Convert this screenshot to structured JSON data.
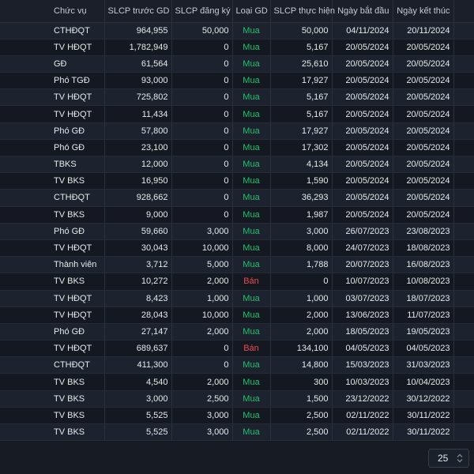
{
  "table": {
    "headers": {
      "role": "Chức vụ",
      "before": "SLCP trước GD",
      "registered": "SLCP đăng ký",
      "type": "Loại GD",
      "executed": "SLCP thực hiện",
      "start": "Ngày bắt đầu",
      "end": "Ngày kết thúc"
    },
    "rows": [
      {
        "role": "CTHĐQT",
        "before": "964,955",
        "registered": "50,000",
        "type": "Mua",
        "executed": "50,000",
        "start": "04/11/2024",
        "end": "20/11/2024"
      },
      {
        "role": "TV HĐQT",
        "before": "1,782,949",
        "registered": "0",
        "type": "Mua",
        "executed": "5,167",
        "start": "20/05/2024",
        "end": "20/05/2024"
      },
      {
        "role": "GĐ",
        "before": "61,564",
        "registered": "0",
        "type": "Mua",
        "executed": "25,610",
        "start": "20/05/2024",
        "end": "20/05/2024"
      },
      {
        "role": "Phó TGĐ",
        "before": "93,000",
        "registered": "0",
        "type": "Mua",
        "executed": "17,927",
        "start": "20/05/2024",
        "end": "20/05/2024"
      },
      {
        "role": "TV HĐQT",
        "before": "725,802",
        "registered": "0",
        "type": "Mua",
        "executed": "5,167",
        "start": "20/05/2024",
        "end": "20/05/2024"
      },
      {
        "role": "TV HĐQT",
        "before": "11,434",
        "registered": "0",
        "type": "Mua",
        "executed": "5,167",
        "start": "20/05/2024",
        "end": "20/05/2024"
      },
      {
        "role": "Phó GĐ",
        "before": "57,800",
        "registered": "0",
        "type": "Mua",
        "executed": "17,927",
        "start": "20/05/2024",
        "end": "20/05/2024"
      },
      {
        "role": "Phó GĐ",
        "before": "23,100",
        "registered": "0",
        "type": "Mua",
        "executed": "17,302",
        "start": "20/05/2024",
        "end": "20/05/2024"
      },
      {
        "role": "TBKS",
        "before": "12,000",
        "registered": "0",
        "type": "Mua",
        "executed": "4,134",
        "start": "20/05/2024",
        "end": "20/05/2024"
      },
      {
        "role": "TV BKS",
        "before": "16,950",
        "registered": "0",
        "type": "Mua",
        "executed": "1,590",
        "start": "20/05/2024",
        "end": "20/05/2024"
      },
      {
        "role": "CTHĐQT",
        "before": "928,662",
        "registered": "0",
        "type": "Mua",
        "executed": "36,293",
        "start": "20/05/2024",
        "end": "20/05/2024"
      },
      {
        "role": "TV BKS",
        "before": "9,000",
        "registered": "0",
        "type": "Mua",
        "executed": "1,987",
        "start": "20/05/2024",
        "end": "20/05/2024"
      },
      {
        "role": "Phó GĐ",
        "before": "59,660",
        "registered": "3,000",
        "type": "Mua",
        "executed": "3,000",
        "start": "26/07/2023",
        "end": "23/08/2023"
      },
      {
        "role": "TV HĐQT",
        "before": "30,043",
        "registered": "10,000",
        "type": "Mua",
        "executed": "8,000",
        "start": "24/07/2023",
        "end": "18/08/2023"
      },
      {
        "role": "Thành viên",
        "before": "3,712",
        "registered": "5,000",
        "type": "Mua",
        "executed": "1,788",
        "start": "20/07/2023",
        "end": "16/08/2023"
      },
      {
        "role": "TV BKS",
        "before": "10,272",
        "registered": "2,000",
        "type": "Bán",
        "executed": "0",
        "start": "10/07/2023",
        "end": "10/08/2023"
      },
      {
        "role": "TV HĐQT",
        "before": "8,423",
        "registered": "1,000",
        "type": "Mua",
        "executed": "1,000",
        "start": "03/07/2023",
        "end": "18/07/2023"
      },
      {
        "role": "TV HĐQT",
        "before": "28,043",
        "registered": "10,000",
        "type": "Mua",
        "executed": "2,000",
        "start": "13/06/2023",
        "end": "11/07/2023"
      },
      {
        "role": "Phó GĐ",
        "before": "27,147",
        "registered": "2,000",
        "type": "Mua",
        "executed": "2,000",
        "start": "18/05/2023",
        "end": "19/05/2023"
      },
      {
        "role": "TV HĐQT",
        "before": "689,637",
        "registered": "0",
        "type": "Bán",
        "executed": "134,100",
        "start": "04/05/2023",
        "end": "04/05/2023"
      },
      {
        "role": "CTHĐQT",
        "before": "411,300",
        "registered": "0",
        "type": "Mua",
        "executed": "14,800",
        "start": "15/03/2023",
        "end": "31/03/2023"
      },
      {
        "role": "TV BKS",
        "before": "4,540",
        "registered": "2,000",
        "type": "Mua",
        "executed": "300",
        "start": "10/03/2023",
        "end": "10/04/2023"
      },
      {
        "role": "TV BKS",
        "before": "3,000",
        "registered": "2,500",
        "type": "Mua",
        "executed": "1,500",
        "start": "23/12/2022",
        "end": "30/12/2022"
      },
      {
        "role": "TV BKS",
        "before": "5,525",
        "registered": "3,000",
        "type": "Mua",
        "executed": "2,500",
        "start": "02/11/2022",
        "end": "30/11/2022"
      },
      {
        "role": "TV BKS",
        "before": "5,525",
        "registered": "3,000",
        "type": "Mua",
        "executed": "2,500",
        "start": "02/11/2022",
        "end": "30/11/2022"
      }
    ]
  },
  "pagination": {
    "page_size": "25"
  },
  "colors": {
    "buy": "#22c06b",
    "sell": "#ef4a4a",
    "background": "#161b24"
  },
  "icons": {
    "page_size_dropdown": "chevron-updown-icon"
  }
}
